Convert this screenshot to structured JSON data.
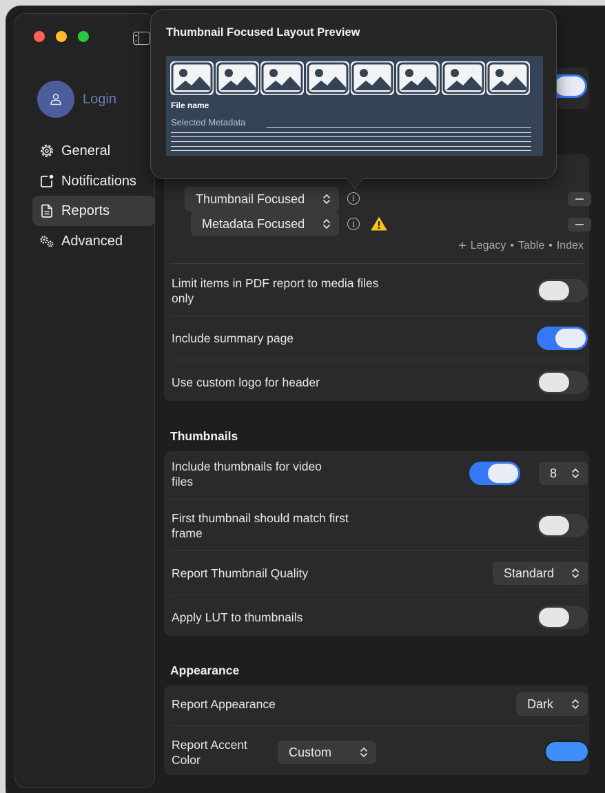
{
  "window": {
    "traffic_lights": [
      "close",
      "minimize",
      "zoom"
    ]
  },
  "sidebar": {
    "login_label": "Login",
    "items": [
      {
        "label": "General",
        "icon": "gear-icon",
        "selected": false
      },
      {
        "label": "Notifications",
        "icon": "notification-icon",
        "selected": false
      },
      {
        "label": "Reports",
        "icon": "document-icon",
        "selected": true
      },
      {
        "label": "Advanced",
        "icon": "gears-icon",
        "selected": false
      }
    ]
  },
  "tooltip": {
    "title": "Thumbnail Focused Layout Preview",
    "file_name": "File name",
    "selected_metadata": "Selected Metadata"
  },
  "reports": {
    "layouts": [
      {
        "value": "Thumbnail Focused",
        "warning": false
      },
      {
        "value": "Metadata Focused",
        "warning": true
      }
    ],
    "add_legacy": "Legacy",
    "add_table": "Table",
    "add_index": "Index",
    "limit_media_label": "Limit items in PDF report to media files only",
    "limit_media_on": false,
    "summary_page_label": "Include summary page",
    "summary_page_on": true,
    "custom_logo_label": "Use custom logo for header",
    "custom_logo_on": false
  },
  "thumbnails": {
    "title": "Thumbnails",
    "video_thumbs_label": "Include thumbnails for video files",
    "video_thumbs_on": true,
    "video_thumbs_count": "8",
    "first_frame_label": "First thumbnail should match first frame",
    "first_frame_on": false,
    "quality_label": "Report Thumbnail Quality",
    "quality_value": "Standard",
    "apply_lut_label": "Apply LUT to thumbnails",
    "apply_lut_on": false
  },
  "appearance": {
    "title": "Appearance",
    "report_appearance_label": "Report Appearance",
    "report_appearance_value": "Dark",
    "accent_label": "Report Accent Color",
    "accent_value": "Custom",
    "accent_color": "#3d8ef8"
  },
  "colors": {
    "accent": "#3478f6",
    "warning": "#f5c518",
    "avatar": "#4b5e9b"
  }
}
